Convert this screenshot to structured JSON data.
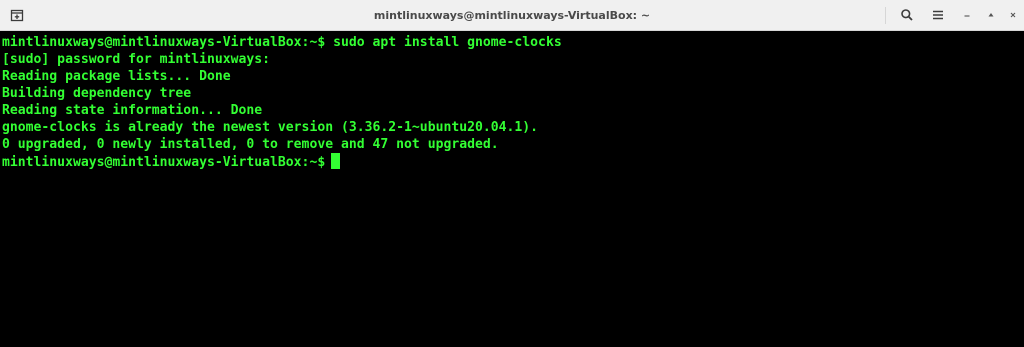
{
  "window": {
    "title": "mintlinuxways@mintlinuxways-VirtualBox: ~"
  },
  "toolbar": {
    "new_tab_icon": "new-tab-icon",
    "search_icon": "search-icon",
    "menu_icon": "hamburger-menu-icon",
    "minimize_icon": "minimize-icon",
    "maximize_icon": "maximize-icon",
    "close_icon": "close-icon"
  },
  "terminal": {
    "prompt": "mintlinuxways@mintlinuxways-VirtualBox:~$ ",
    "command": "sudo apt install gnome-clocks",
    "output": [
      "[sudo] password for mintlinuxways:",
      "Reading package lists... Done",
      "Building dependency tree",
      "Reading state information... Done",
      "gnome-clocks is already the newest version (3.36.2-1~ubuntu20.04.1).",
      "0 upgraded, 0 newly installed, 0 to remove and 47 not upgraded."
    ],
    "final_prompt": "mintlinuxways@mintlinuxways-VirtualBox:~$"
  },
  "colors": {
    "text": "#33ff33",
    "background": "#000000",
    "titlebar": "#f0f0f0"
  }
}
